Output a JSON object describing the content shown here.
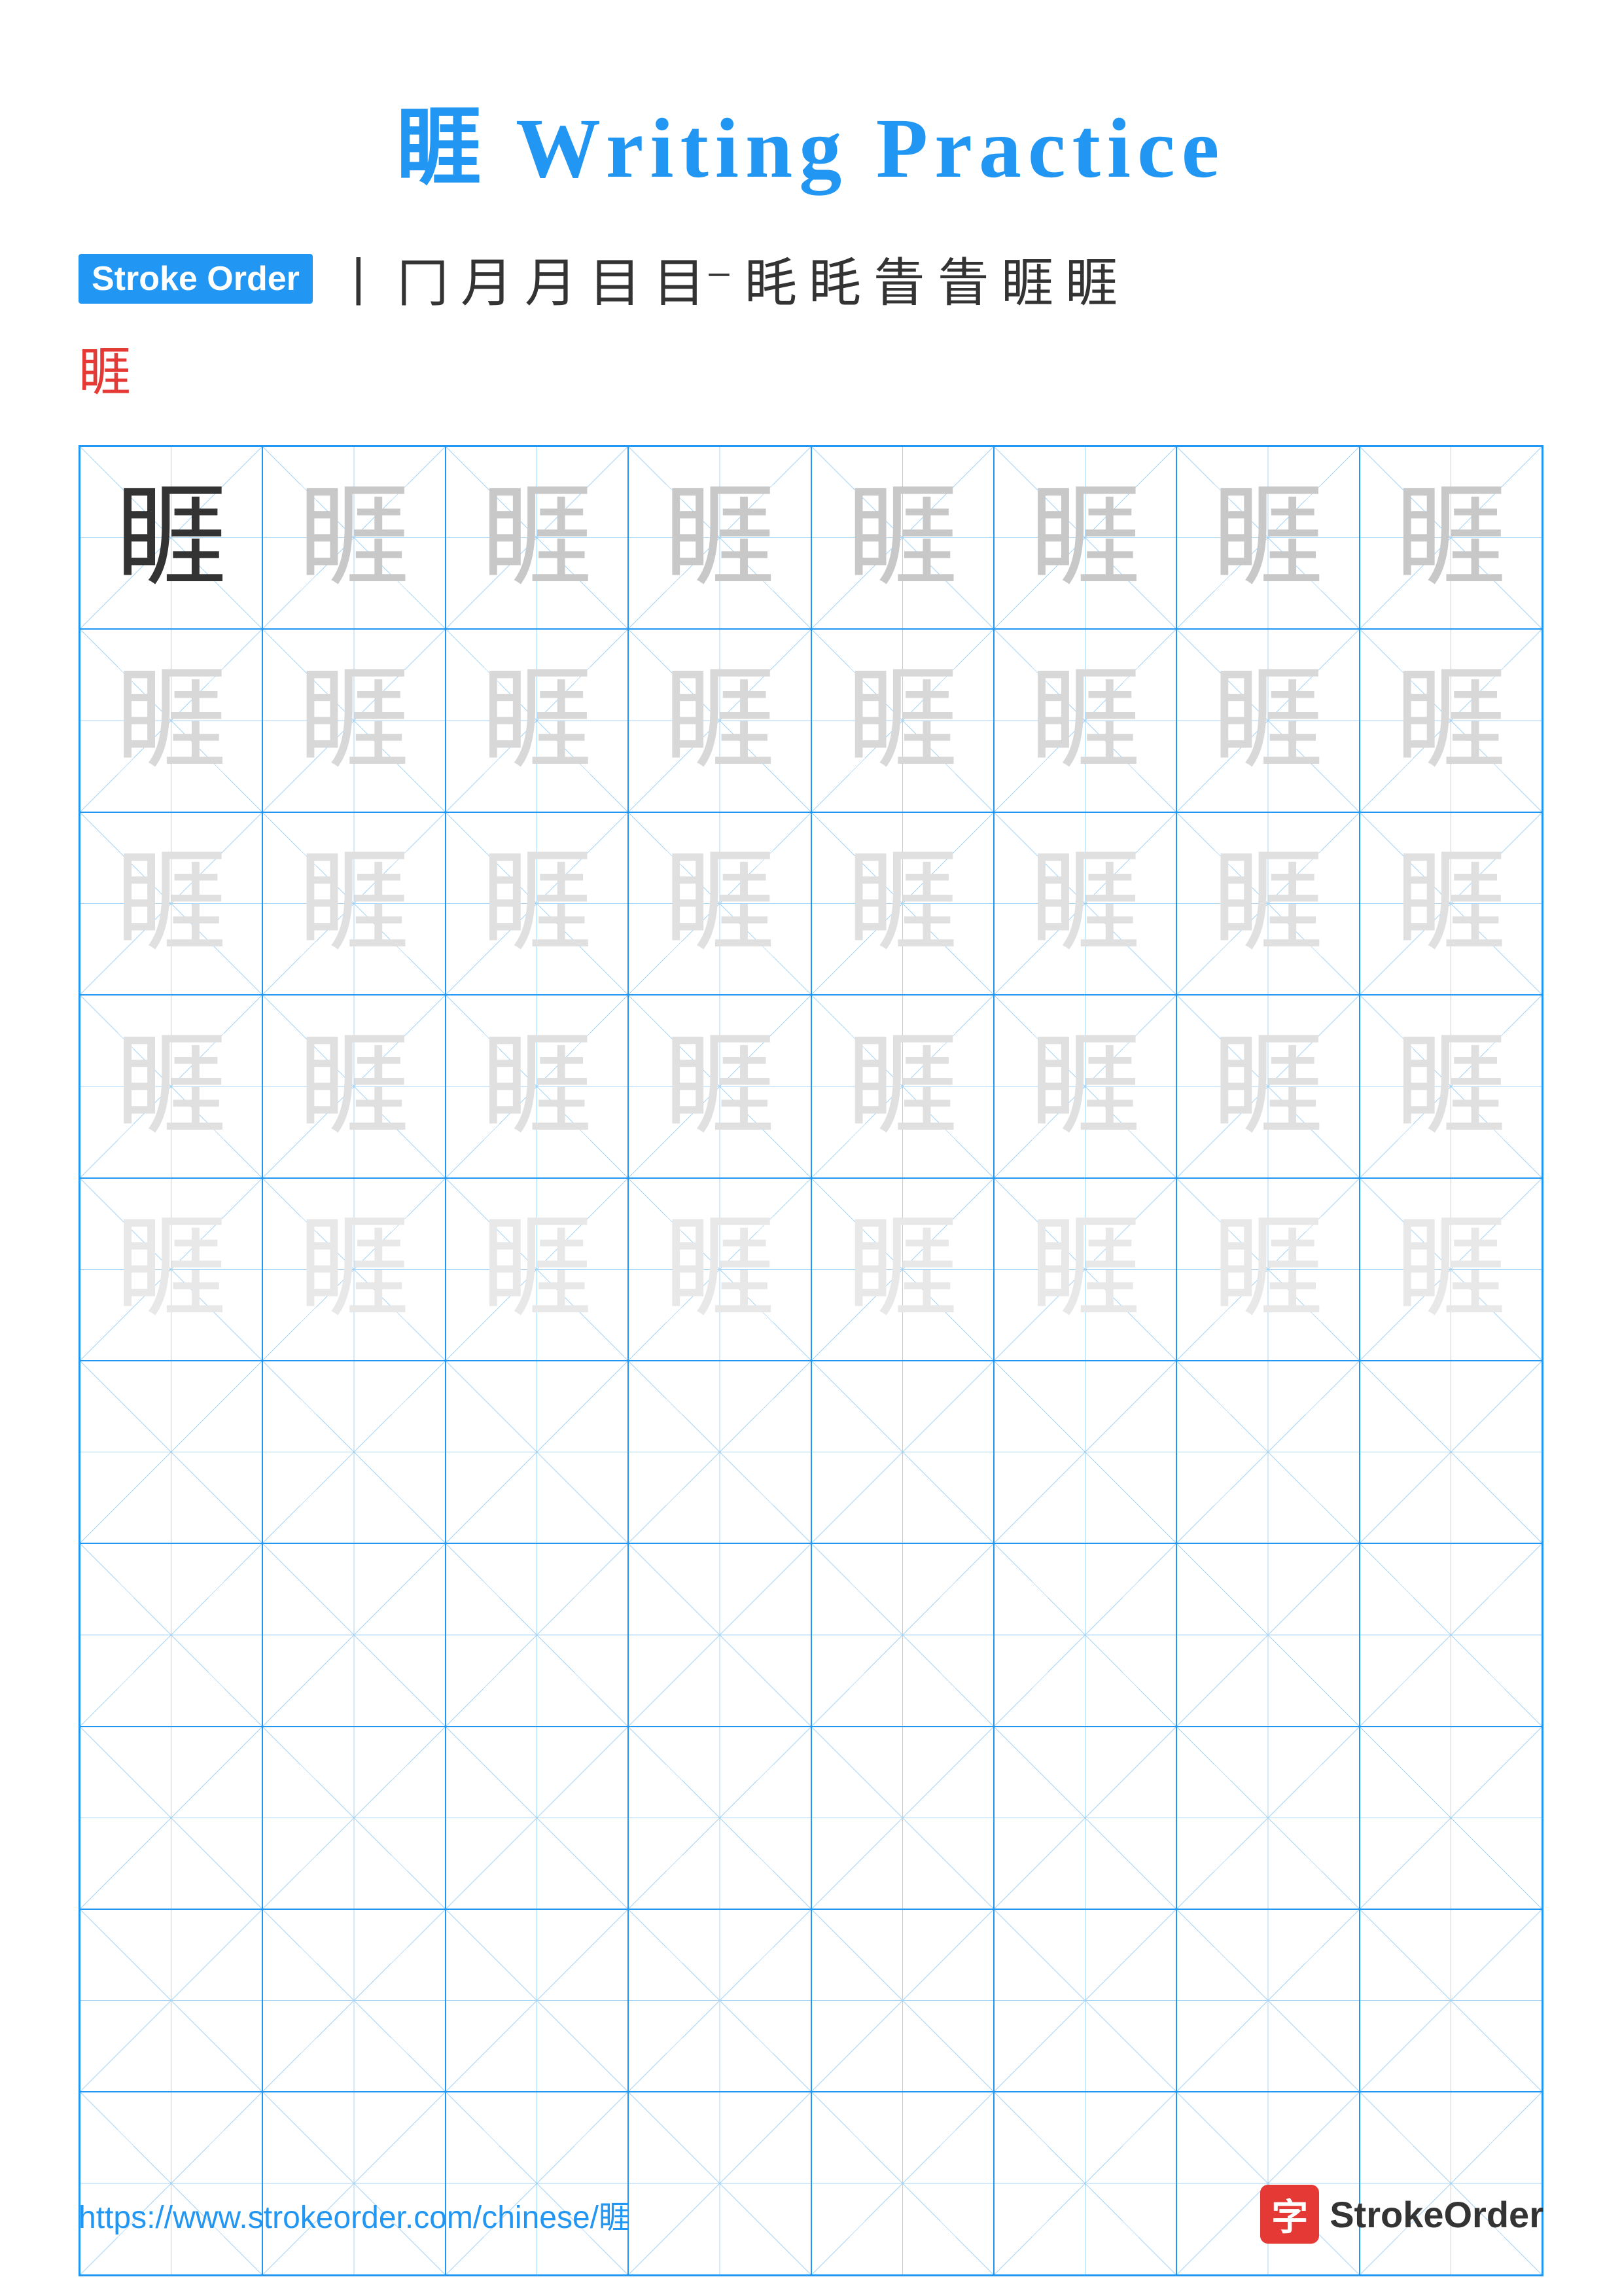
{
  "title": "睚 Writing Practice",
  "stroke_order": {
    "label": "Stroke Order",
    "characters": [
      "丨",
      "冂",
      "月",
      "月",
      "目",
      "目",
      "眊",
      "眊",
      "眊",
      "眚",
      "眚",
      "眚",
      "睚"
    ],
    "final_char": "睚"
  },
  "character": "睚",
  "grid": {
    "rows": 10,
    "cols": 8,
    "filled_rows": 5,
    "empty_rows": 5
  },
  "footer": {
    "url": "https://www.strokeorder.com/chinese/睚",
    "logo_char": "字",
    "logo_text": "StrokeOrder"
  }
}
